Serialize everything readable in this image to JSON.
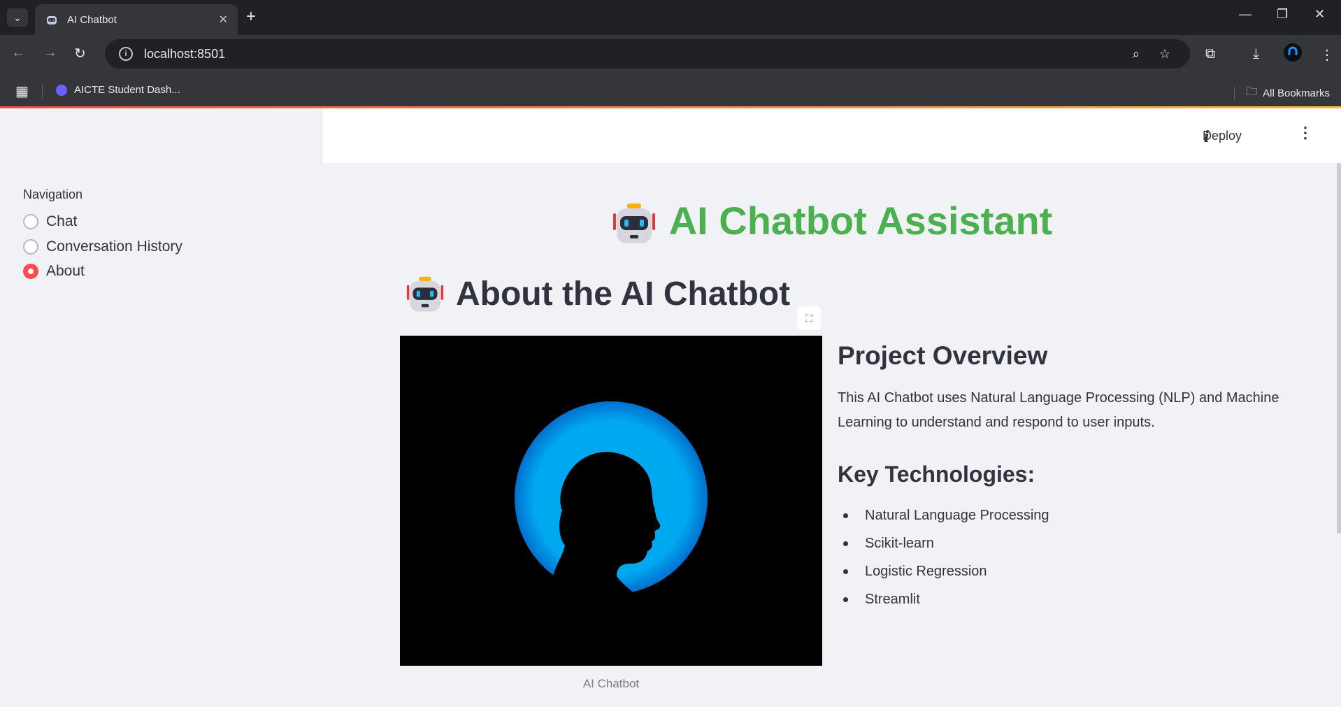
{
  "browser": {
    "tab_title": "AI Chatbot",
    "url": "localhost:8501",
    "bookmark_item": "AICTE Student Dash...",
    "all_bookmarks": "All Bookmarks"
  },
  "sidebar": {
    "nav_label": "Navigation",
    "items": [
      {
        "label": "Chat",
        "selected": false
      },
      {
        "label": "Conversation History",
        "selected": false
      },
      {
        "label": "About",
        "selected": true
      }
    ]
  },
  "header": {
    "deploy_label": "Deploy"
  },
  "main": {
    "app_title": "AI Chatbot Assistant",
    "about_title": "About the AI Chatbot",
    "image_caption": "AI Chatbot",
    "overview_heading": "Project Overview",
    "overview_text": "This AI Chatbot uses Natural Language Processing (NLP) and Machine Learning to understand and respond to user inputs.",
    "tech_heading": "Key Technologies:",
    "technologies": [
      "Natural Language Processing",
      "Scikit-learn",
      "Logistic Regression",
      "Streamlit"
    ]
  },
  "colors": {
    "accent": "#ff4b4b",
    "title_green": "#4caf50",
    "image_circle": "#00a8f0"
  }
}
